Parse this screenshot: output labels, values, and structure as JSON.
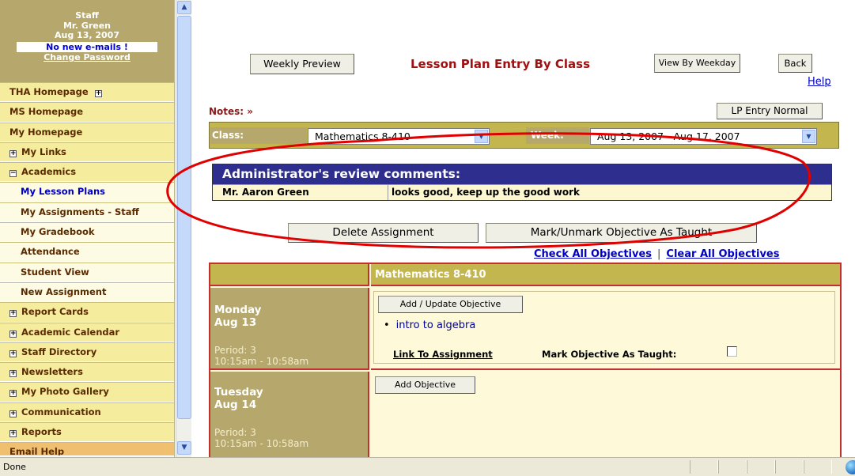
{
  "user": {
    "role": "Staff",
    "name": "Mr. Green",
    "date": "Aug 13, 2007",
    "email_status": "No new e-mails !",
    "change_password": "Change Password"
  },
  "sidebar": {
    "items": [
      {
        "label": "THA Homepage",
        "marker": "+"
      },
      {
        "label": "MS Homepage"
      },
      {
        "label": "My Homepage"
      },
      {
        "label": "My Links",
        "marker": "+"
      },
      {
        "label": "Academics",
        "marker": "−"
      },
      {
        "label": "My Lesson Plans",
        "sub": true,
        "active": true
      },
      {
        "label": "My Assignments - Staff",
        "sub": true
      },
      {
        "label": "My Gradebook",
        "sub": true
      },
      {
        "label": "Attendance",
        "sub": true
      },
      {
        "label": "Student View",
        "sub": true
      },
      {
        "label": "New Assignment",
        "sub": true
      },
      {
        "label": "Report Cards",
        "marker": "+"
      },
      {
        "label": "Academic Calendar",
        "marker": "+"
      },
      {
        "label": "Staff Directory",
        "marker": "+"
      },
      {
        "label": "Newsletters",
        "marker": "+"
      },
      {
        "label": "My Photo Gallery",
        "marker": "+"
      },
      {
        "label": "Communication",
        "marker": "+"
      },
      {
        "label": "Reports",
        "marker": "+"
      },
      {
        "label": "Email Help"
      }
    ]
  },
  "toolbar": {
    "weekly_preview": "Weekly Preview",
    "title": "Lesson Plan Entry By Class",
    "view_by_weekday": "View By Weekday",
    "back": "Back",
    "help": "Help"
  },
  "notes": {
    "label": "Notes: »",
    "lp_entry": "LP Entry Normal"
  },
  "filters": {
    "class_label": "Class:",
    "class_value": "Mathematics 8-410",
    "week_label": "Week:",
    "week_value": "Aug 13, 2007 - Aug 17, 2007"
  },
  "admin_review": {
    "heading": "Administrator's review comments:",
    "reviewer": "Mr. Aaron Green",
    "comment": "looks good, keep up the good work"
  },
  "actions": {
    "delete_assignment": "Delete Assignment",
    "mark_unmark": "Mark/Unmark Objective As Taught",
    "check_all": "Check All Objectives",
    "separator": "|",
    "clear_all": "Clear All Objectives"
  },
  "plan": {
    "class_header": "Mathematics 8-410",
    "days": [
      {
        "day": "Monday",
        "date": "Aug 13",
        "period": "Period: 3",
        "time": "10:15am - 10:58am",
        "button": "Add / Update Objective",
        "objectives": [
          "intro to algebra"
        ],
        "link_to_assignment": "Link To Assignment",
        "mark_taught": "Mark Objective As Taught:",
        "taught": false
      },
      {
        "day": "Tuesday",
        "date": "Aug 14",
        "period": "Period: 3",
        "time": "10:15am - 10:58am",
        "button": "Add Objective"
      }
    ]
  },
  "status": {
    "text": "Done"
  },
  "colors": {
    "title_red": "#a01010",
    "sidebar_tan": "#b6a86c",
    "admin_navy": "#2e2e8e",
    "link_blue": "#0000c0",
    "annotation_red": "#e00000"
  }
}
